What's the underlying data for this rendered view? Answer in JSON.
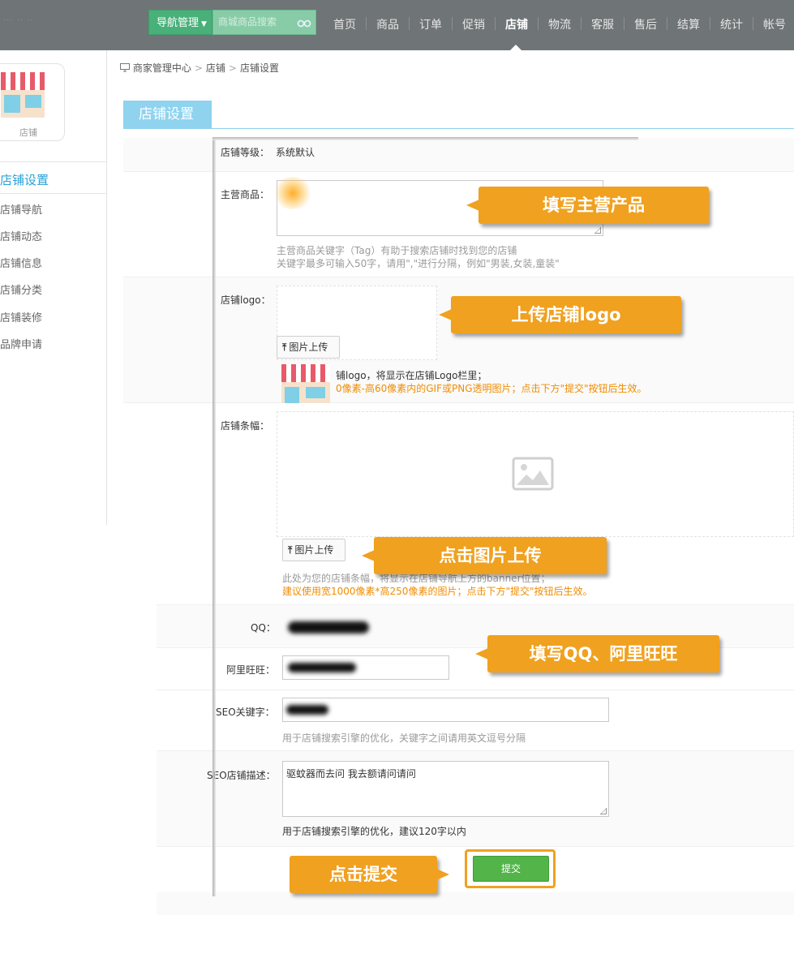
{
  "topbar": {
    "faint_text": "··· ·· ··",
    "nav_management": "导航管理",
    "search_placeholder": "商城商品搜索",
    "nav": [
      "首页",
      "商品",
      "订单",
      "促销",
      "店铺",
      "物流",
      "客服",
      "售后",
      "结算",
      "统计",
      "帐号"
    ],
    "active_nav": "店铺"
  },
  "sidebar": {
    "card_label": "店铺",
    "active_item": "店铺设置",
    "items": [
      "店铺导航",
      "店铺动态",
      "店铺信息",
      "店铺分类",
      "店铺装修",
      "品牌申请"
    ]
  },
  "breadcrumb": {
    "items": [
      "商家管理中心",
      "店铺",
      "店铺设置"
    ]
  },
  "section_title": "店铺设置",
  "form": {
    "level": {
      "label": "店铺等级：",
      "value": "系统默认"
    },
    "main_goods": {
      "label": "主营商品：",
      "hint1": "主营商品关键字（Tag）有助于搜索店铺时找到您的店铺",
      "hint2": "关键字最多可输入50字，请用\",\"进行分隔，例如\"男装,女装,童装\""
    },
    "logo": {
      "label": "店铺logo：",
      "upload_button": "图片上传",
      "hint1": "铺logo，将显示在店铺Logo栏里；",
      "hint2": "0像素-高60像素内的GIF或PNG透明图片；点击下方\"提交\"按钮后生效。"
    },
    "banner": {
      "label": "店铺条幅：",
      "upload_button": "图片上传",
      "hint1": "此处为您的店铺条幅，将显示在店铺导航上方的banner位置；",
      "hint2": "建议使用宽1000像素*高250像素的图片；点击下方\"提交\"按钮后生效。"
    },
    "qq": {
      "label": "QQ："
    },
    "wangwang": {
      "label": "阿里旺旺："
    },
    "seo_keywords": {
      "label": "SEO关键字：",
      "hint": "用于店铺搜索引擎的优化，关键字之间请用英文逗号分隔"
    },
    "seo_desc": {
      "label": "SEO店铺描述：",
      "value": "驱蚊器而去问 我去额请问请问",
      "hint": "用于店铺搜索引擎的优化，建议120字以内"
    },
    "submit_label": "提交"
  },
  "callouts": {
    "main_goods": "填写主营产品",
    "logo": "上传店铺logo",
    "banner": "点击图片上传",
    "contacts": "填写QQ、阿里旺旺",
    "submit": "点击提交"
  },
  "colors": {
    "accent_blue": "#2aa1d6",
    "tab_blue": "#8fd3ef",
    "nav_green": "#49b07a",
    "callout_orange": "#f0a11f",
    "submit_green": "#52b449",
    "hint_orange": "#f08c00"
  }
}
